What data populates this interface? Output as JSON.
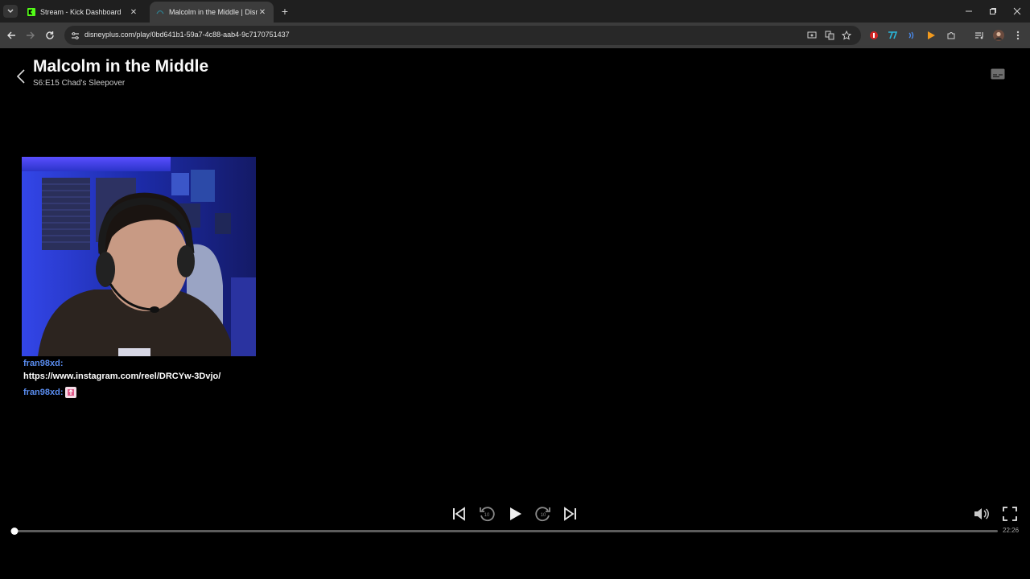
{
  "browser": {
    "tabs": [
      {
        "title": "Stream - Kick Dashboard",
        "favicon": "kick-icon",
        "active": false
      },
      {
        "title": "Malcolm in the Middle | Disney+",
        "favicon": "disneyplus-icon",
        "active": true
      }
    ],
    "url": "disneyplus.com/play/0bd641b1-59a7-4c88-aab4-9c7170751437"
  },
  "player": {
    "show_title": "Malcolm in the Middle",
    "episode_title": "S6:E15 Chad's Sleepover",
    "remaining_time": "22:26",
    "progress": 0.0
  },
  "chat": [
    {
      "user": "fran98xd:",
      "message": "https://www.instagram.com/reel/DRCYw-3Dvjo/"
    },
    {
      "user": "fran98xd:",
      "message": "",
      "emote": "sticker-emote"
    }
  ],
  "colors": {
    "chat_username": "#5a8df0",
    "kick_green": "#53fc18",
    "webcam_light": "#2b3bd6"
  }
}
